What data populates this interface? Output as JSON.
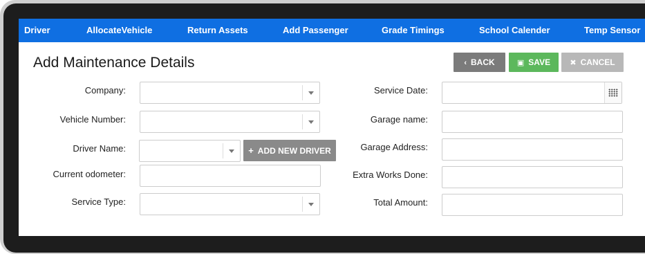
{
  "nav": {
    "items": [
      {
        "label": "Driver"
      },
      {
        "label": "AllocateVehicle"
      },
      {
        "label": "Return Assets"
      },
      {
        "label": "Add Passenger"
      },
      {
        "label": "Grade Timings"
      },
      {
        "label": "School Calender"
      },
      {
        "label": "Temp Sensor"
      }
    ],
    "color": "#0f6fe2"
  },
  "header": {
    "title": "Add Maintenance Details",
    "back_label": "BACK",
    "save_label": "SAVE",
    "cancel_label": "CANCEL",
    "back_icon": "chevron-left-icon",
    "save_icon": "floppy-disk-icon",
    "cancel_icon": "close-icon",
    "colors": {
      "back": "#7b7b7b",
      "save": "#5cb85c",
      "cancel": "#b8b8b8"
    }
  },
  "form": {
    "company": {
      "label": "Company:",
      "value": ""
    },
    "vehicle_number": {
      "label": "Vehicle Number:",
      "value": ""
    },
    "driver_name": {
      "label": "Driver Name:",
      "value": ""
    },
    "add_new_driver_label": "ADD NEW DRIVER",
    "current_odometer": {
      "label": "Current odometer:",
      "value": ""
    },
    "service_type": {
      "label": "Service Type:",
      "value": ""
    },
    "service_date": {
      "label": "Service Date:",
      "value": ""
    },
    "garage_name": {
      "label": "Garage name:",
      "value": ""
    },
    "garage_address": {
      "label": "Garage Address:",
      "value": ""
    },
    "extra_works_done": {
      "label": "Extra Works Done:",
      "value": ""
    },
    "total_amount": {
      "label": "Total Amount:",
      "value": ""
    }
  }
}
